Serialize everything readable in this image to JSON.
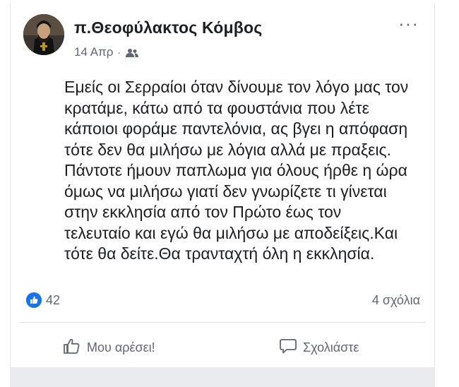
{
  "post": {
    "author": "π.Θεοφύλακτος Κόμβος",
    "date": "14 Απρ",
    "separator": "·",
    "audience_icon": "friends-icon",
    "more_icon": "more-horizontal-icon",
    "more_label": "···",
    "text": "Εμείς οι Σερραίοι όταν δίνουμε τον λόγο μας τον\nκρατάμε, κάτω από τα φουστάνια που λέτε\nκάποιοι φοράμε παντελόνια, ας βγει η απόφαση\nτότε δεν θα μιλήσω  με λόγια αλλά με πραξεις.\nΠάντοτε ήμουν παπλωμα για όλους ήρθε η ώρα\nόμως να μιλήσω γιατί δεν γνωρίζετε τι γίνεται\nστην εκκλησία από τον Πρώτο έως τον\nτελευταίο και εγώ θα μιλήσω με αποδείξεις.Και\nτότε θα δείτε.Θα τρανταχτή όλη η εκκλησία."
  },
  "stats": {
    "reaction_icon": "like-reaction-icon",
    "reaction_count": "42",
    "comments": "4 σχόλια"
  },
  "actions": {
    "like_label": "Μου αρέσει!",
    "like_icon": "thumbs-up-icon",
    "comment_label": "Σχολιάστε",
    "comment_icon": "speech-bubble-icon"
  },
  "colors": {
    "text": "#1c1e21",
    "secondary": "#616770",
    "accent": "#1b74e4"
  }
}
